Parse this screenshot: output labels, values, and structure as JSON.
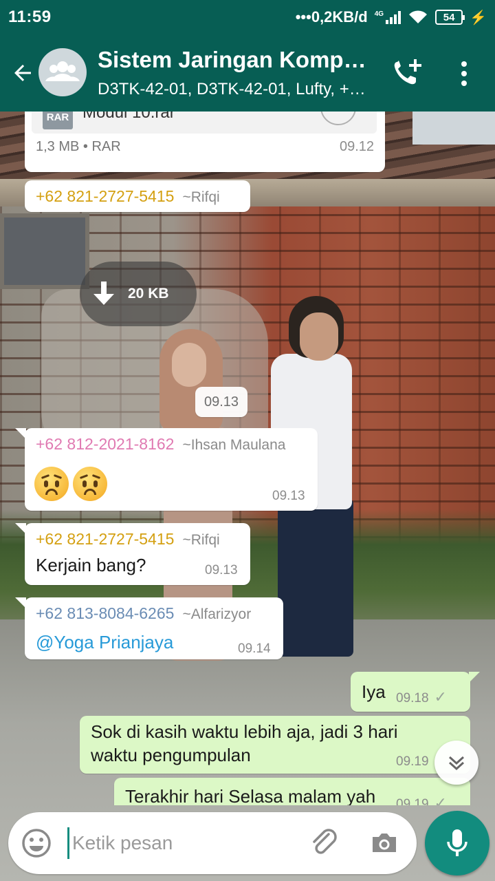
{
  "status_bar": {
    "time": "11:59",
    "network_speed": "0,2KB/d",
    "network_type": "4G",
    "battery": "54"
  },
  "toolbar": {
    "title": "Sistem Jaringan Komp…",
    "subtitle": "D3TK-42-01, D3TK-42-01, Lufty, +…",
    "back_icon": "arrow-left-icon",
    "call_icon": "add-call-icon",
    "menu_icon": "more-vert-icon"
  },
  "messages": {
    "file": {
      "badge": "RAR",
      "name": "Modul 10.rar",
      "meta": "1,3 MB • RAR",
      "time": "09.12"
    },
    "sender_rifqi_1": {
      "number": "+62 821-2727-5415",
      "nick": "~Rifqi"
    },
    "media": {
      "size": "20 KB"
    },
    "media_time": "09.13",
    "ihsan": {
      "number": "+62 812-2021-8162",
      "nick": "~Ihsan Maulana",
      "time": "09.13",
      "emoji_count": 2
    },
    "rifqi_2": {
      "number": "+62 821-2727-5415",
      "nick": "~Rifqi",
      "text": "Kerjain bang?",
      "time": "09.13"
    },
    "alfarizyor": {
      "number": "+62 813-8084-6265",
      "nick": "~Alfarizyor",
      "text": "@Yoga Prianjaya",
      "time": "09.14"
    },
    "out_1": {
      "text": "Iya",
      "time": "09.18"
    },
    "out_2": {
      "line1": "Sok di kasih waktu lebih aja, jadi 3 hari",
      "line2": "waktu pengumpulan",
      "time": "09.19"
    },
    "out_3": {
      "text": "Terakhir hari Selasa malam yah",
      "time": "09.19"
    }
  },
  "composer": {
    "placeholder": "Ketik pesan"
  },
  "colors": {
    "header": "#075e54",
    "accent": "#128c7e",
    "outgoing_bubble": "#dcf8c6",
    "sender_gold": "#d4a012",
    "sender_pink": "#e07ab2",
    "sender_slate": "#6a8cb4",
    "mention": "#279ad8"
  }
}
